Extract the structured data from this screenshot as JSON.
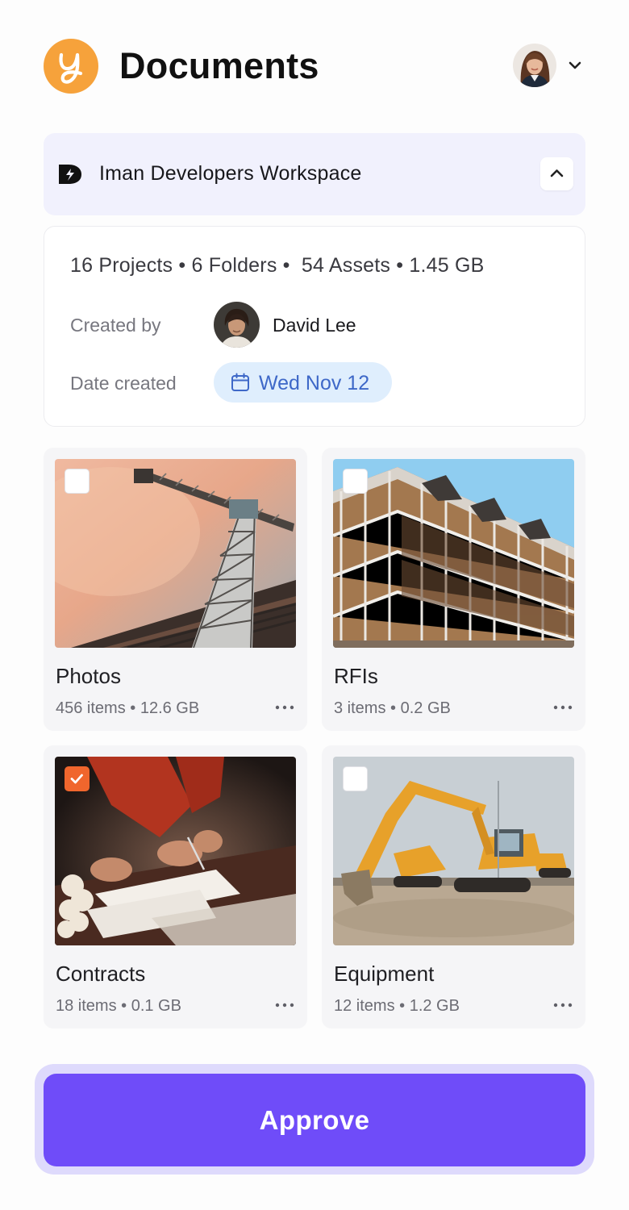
{
  "header": {
    "title": "Documents",
    "logo_icon": "brand-y-logo",
    "accent": "#f6a23b"
  },
  "workspace": {
    "name": "Iman Developers Workspace",
    "icon": "workspace-d-logo",
    "toggle_icon": "chevron-up-icon",
    "bg": "#f1f1fd"
  },
  "info": {
    "stats": "16 Projects • 6 Folders •  54 Assets • 1.45 GB",
    "created_by_label": "Created by",
    "created_by_name": "David Lee",
    "date_created_label": "Date created",
    "date_created_value": "Wed Nov 12",
    "date_icon": "calendar-icon"
  },
  "folders": [
    {
      "name": "Photos",
      "meta": "456 items • 12.6 GB",
      "checked": false,
      "more_icon": "more-dots-icon"
    },
    {
      "name": "RFIs",
      "meta": "3 items • 0.2 GB",
      "checked": false,
      "more_icon": "more-dots-icon"
    },
    {
      "name": "Contracts",
      "meta": "18 items • 0.1 GB",
      "checked": true,
      "more_icon": "more-dots-icon"
    },
    {
      "name": "Equipment",
      "meta": "12 items • 1.2 GB",
      "checked": false,
      "more_icon": "more-dots-icon"
    }
  ],
  "actions": {
    "approve_label": "Approve",
    "approve_color": "#6f4cf9"
  },
  "colors": {
    "checked": "#f0662d",
    "date_text": "#3e68c8",
    "date_bg": "#dfeefd"
  }
}
